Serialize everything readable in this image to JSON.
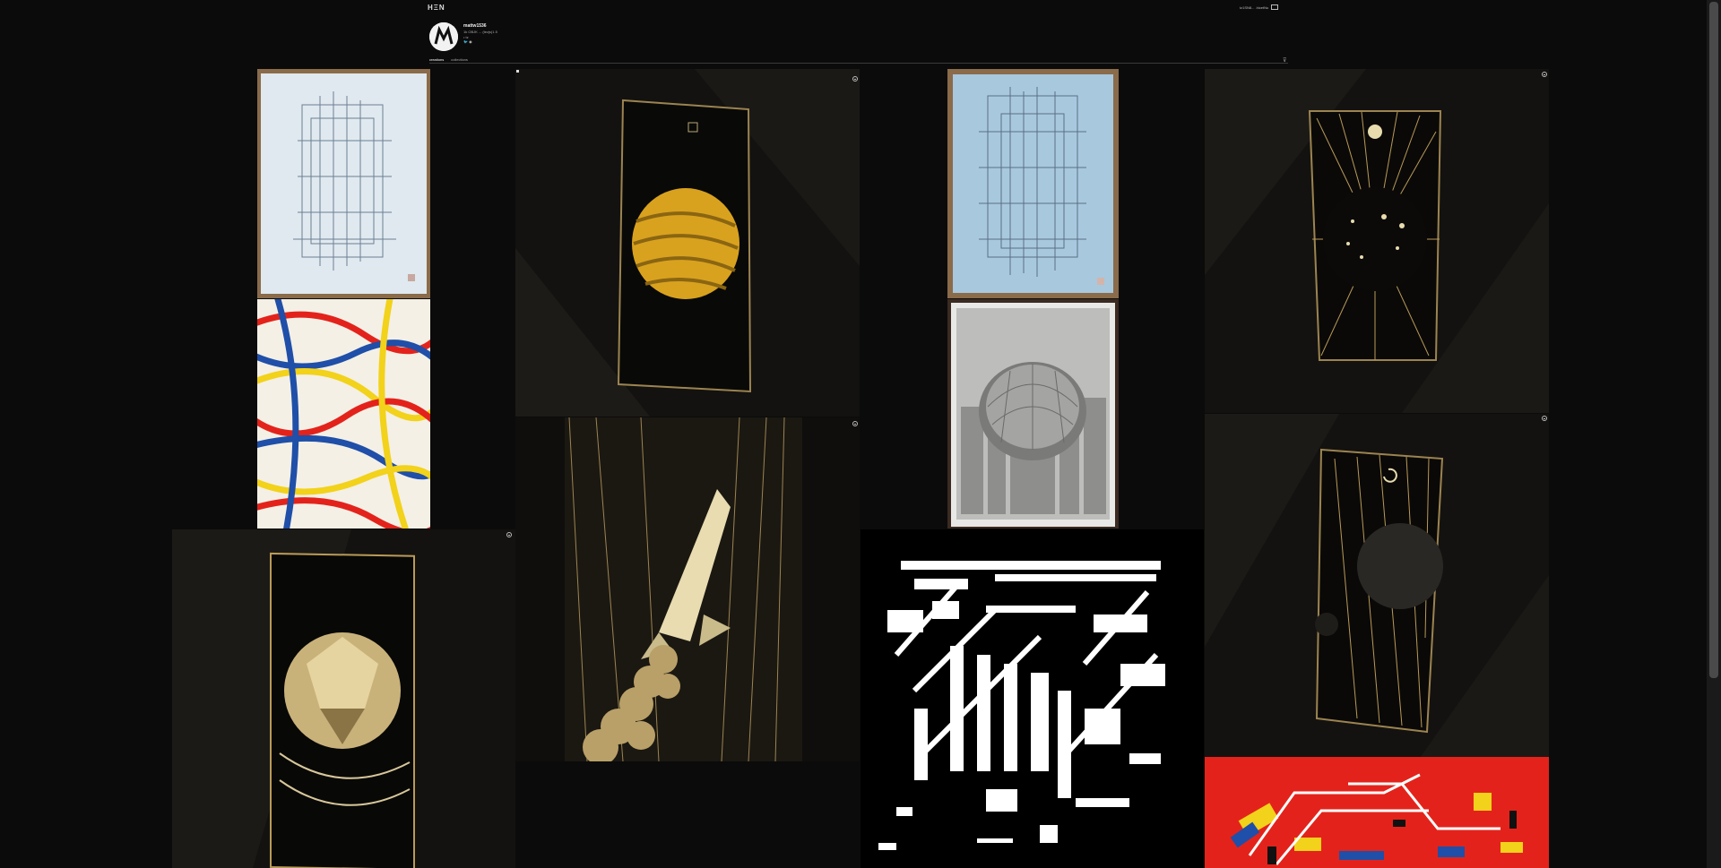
{
  "header": {
    "logo_text": "HΞN",
    "wallet_text": "tz1SN8... .hicetNu"
  },
  "profile": {
    "username": "mattw1536",
    "stats": "1k OBJK ... (tezjs)1.5",
    "bio": "•  tz",
    "social": "🐦 ◉"
  },
  "tabs": [
    {
      "label": "creations",
      "active": true
    },
    {
      "label": "collections",
      "active": false
    }
  ],
  "icons": {
    "filter": "filter-icon",
    "more": "more-options-icon",
    "wallet": "wallet-icon"
  },
  "colors": {
    "background": "#0b0b0b",
    "gold": "#c9a24a",
    "red": "#e3231b",
    "paper_blue": "#cfe2ee"
  }
}
